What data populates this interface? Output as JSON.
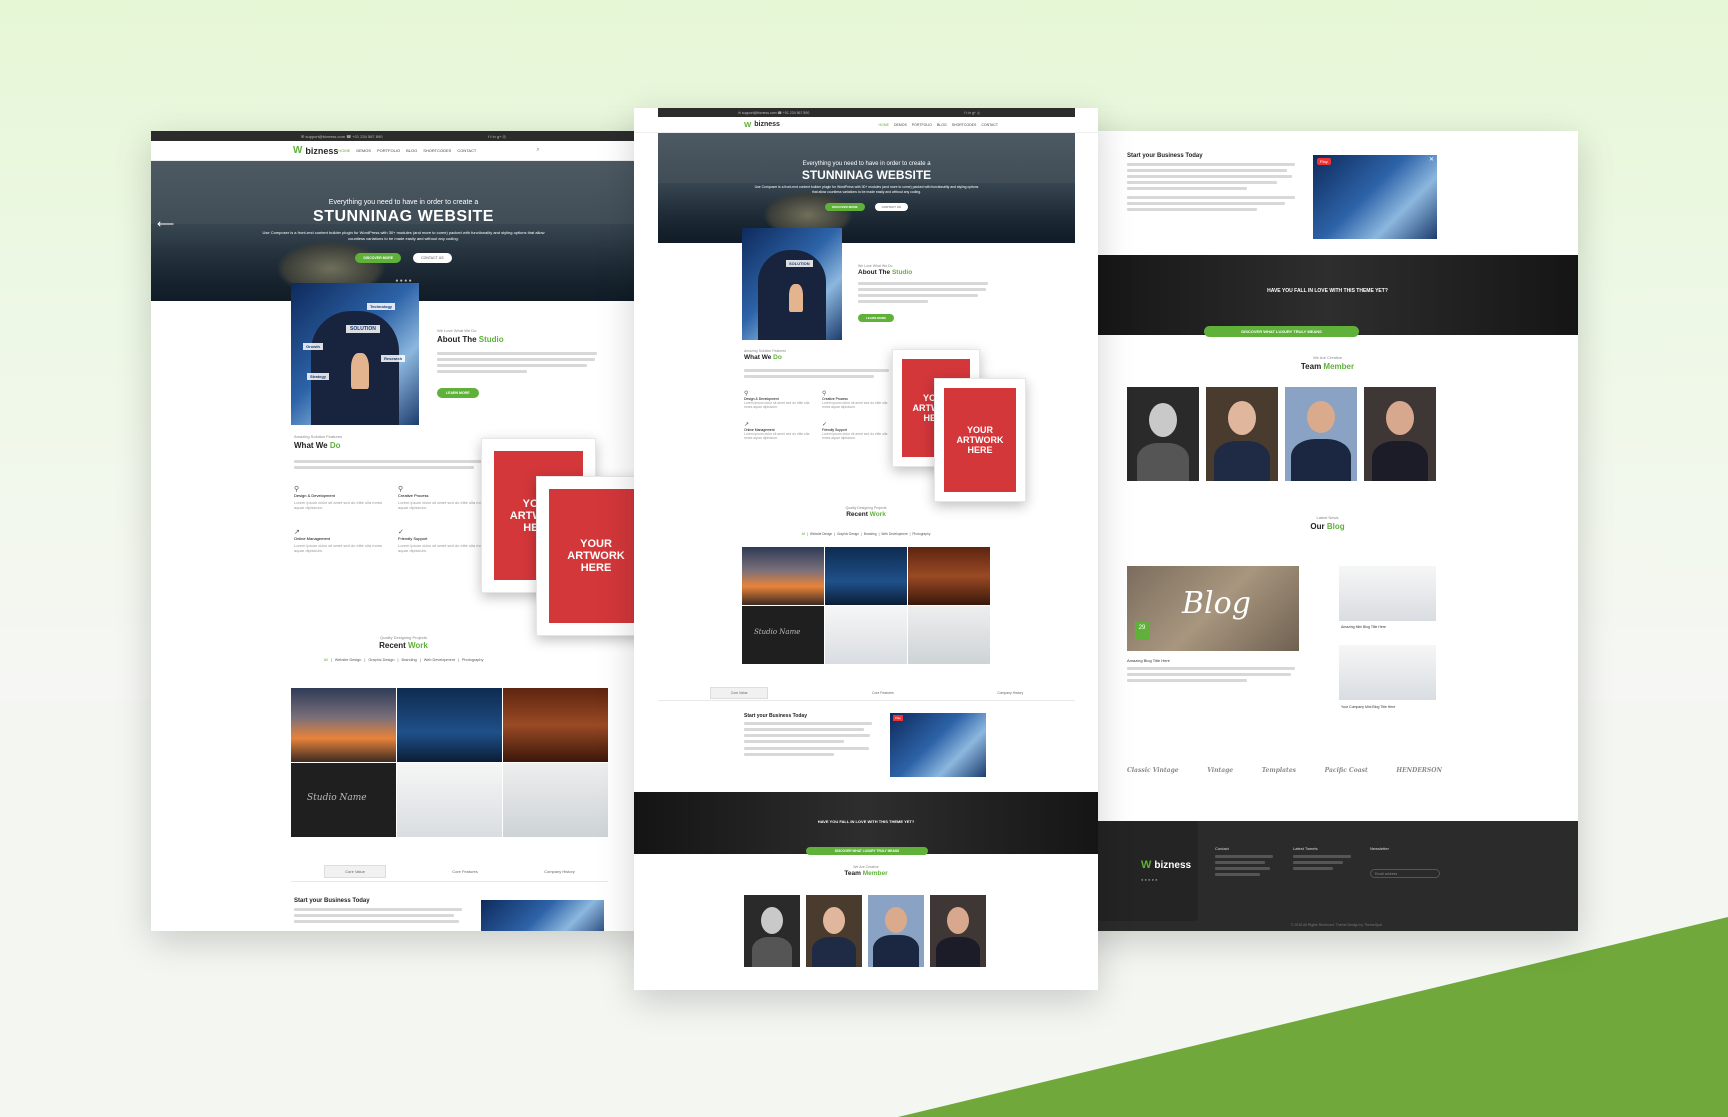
{
  "brand": {
    "logo": "bizness",
    "accent": "#5fb13a",
    "dark": "#2b2b2b",
    "bg_green": "#70a83b"
  },
  "topbar": {
    "left": "✉ support@bizness.com  ☎ +01 234 567 890",
    "right": "f t in g+ ◎"
  },
  "nav": {
    "items": [
      "HOME",
      "DEMOS",
      "PORTFOLIO",
      "BLOG",
      "SHORTCODES",
      "CONTACT"
    ],
    "search_icon": "search-icon"
  },
  "hero": {
    "pre": "Everything you need to have in order to create a",
    "title": "STUNNINAG WEBSITE",
    "desc": "Use Composer is a front-end content builder plugin for WordPress with 30+ modules (and more to come) packed with functionality and styling options that allow countless variations to be made easily and without any coding.",
    "btn_primary": "DISCOVER MORE",
    "btn_secondary": "CONTACT US",
    "arrow_icon": "arrow-left-icon"
  },
  "about": {
    "kicker": "We Love What We Do",
    "title_a": "About The ",
    "title_b": "Studio",
    "btn": "LEARN MORE",
    "tags": [
      "Technology",
      "SOLUTION",
      "Research",
      "Growth",
      "Strategy"
    ]
  },
  "what": {
    "kicker": "Amazing Solution Features",
    "title_a": "What We ",
    "title_b": "Do",
    "features": [
      {
        "name": "Design & Development",
        "icon": "bicycle-icon"
      },
      {
        "name": "Creative Process",
        "icon": "bicycle-icon"
      },
      {
        "name": "Online Management",
        "icon": "trend-up-icon"
      },
      {
        "name": "Friendly Support",
        "icon": "check-icon"
      }
    ],
    "feature_desc": "Lorem ipsum dolor sit amet sed do elite ulla mnes aquar dipisicum."
  },
  "artwork": {
    "line1": "YOUR",
    "line2": "ARTWORK",
    "line3": "HERE"
  },
  "recent": {
    "kicker": "Quality Designing Projects",
    "title_a": "Recent ",
    "title_b": "Work",
    "filters": [
      "All",
      "Website Design",
      "Graphic Design",
      "Branding",
      "Web Development",
      "Photography"
    ],
    "thumb_caption": "Studio Name"
  },
  "tabs": {
    "items": [
      "Core Value",
      "Core Features",
      "Company History"
    ]
  },
  "business": {
    "title": "Start your Business Today",
    "play_badge": "Play"
  },
  "love": {
    "text": "HAVE YOU FALL IN LOVE WITH THIS THEME YET?",
    "btn": "DISCOVER WHAT LUXURY TRULY MEANS"
  },
  "team": {
    "kicker": "We Are Creative",
    "title_a": "Team ",
    "title_b": "Member"
  },
  "blog": {
    "kicker": "Latest News",
    "title_a": "Our ",
    "title_b": "Blog",
    "feature_word": "Blog",
    "date": "29",
    "posts": [
      "Amazing Blog Title Here",
      "Amazing Mini Blog Title Here",
      "Your Company Mini Blog Title Here"
    ]
  },
  "logos": [
    "Classic Vintage",
    "Vintage",
    "Templates",
    "Pacific Coast",
    "HENDERSON"
  ],
  "footer": {
    "cols": [
      "Contact",
      "Latest Tweets",
      "Newsletter"
    ],
    "email_placeholder": "Email address",
    "copyright": "© 2016 All Rights Reserved. Theme Design by ThemeSpot"
  }
}
